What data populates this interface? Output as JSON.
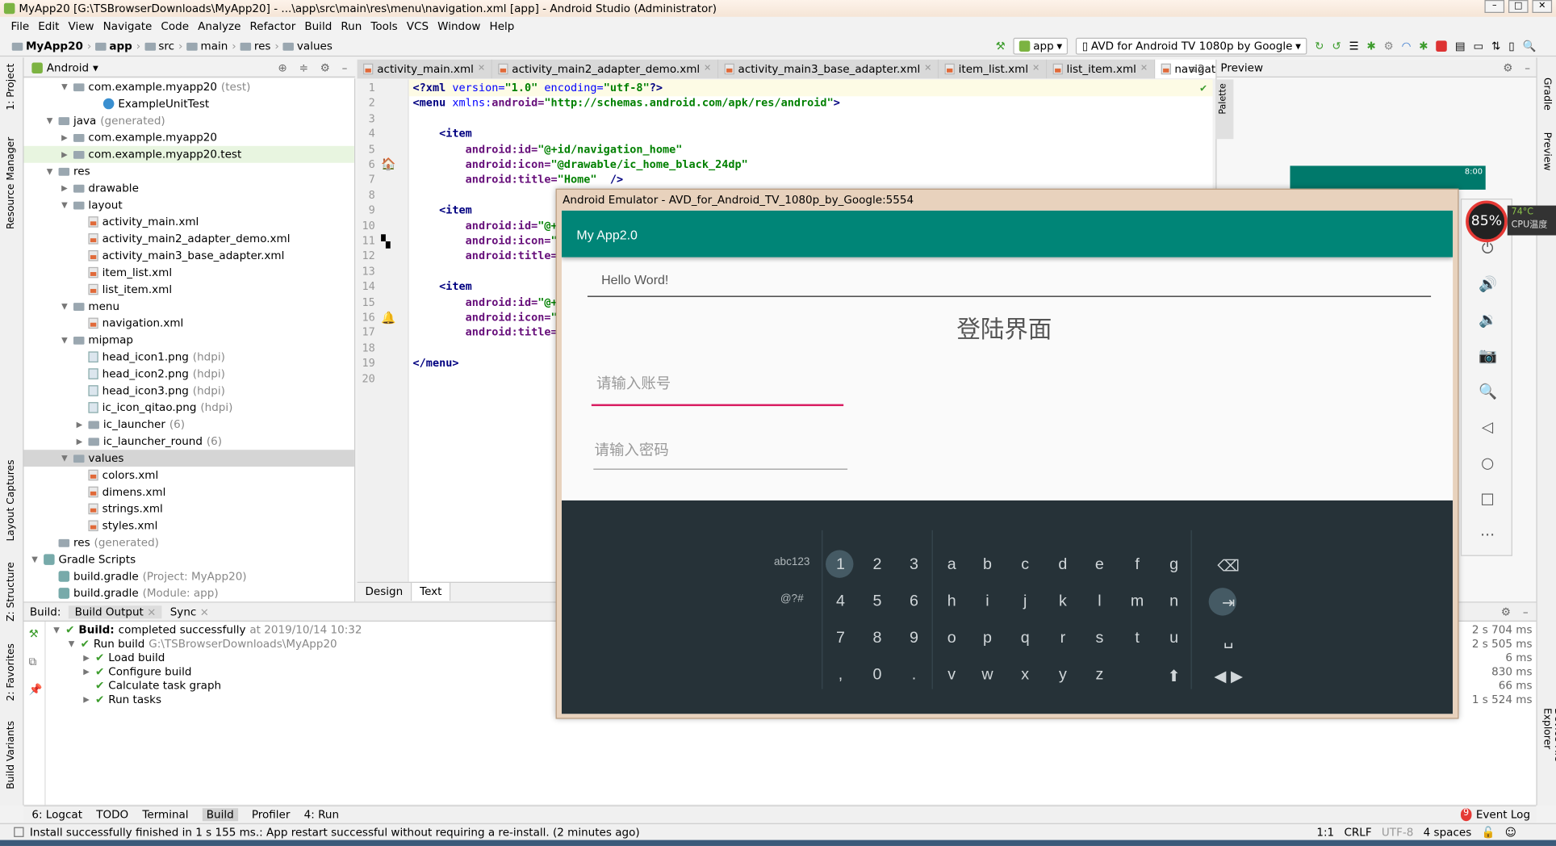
{
  "window": {
    "title": "MyApp20 [G:\\TSBrowserDownloads\\MyApp20] - ...\\app\\src\\main\\res\\menu\\navigation.xml [app] - Android Studio (Administrator)"
  },
  "menu": [
    "File",
    "Edit",
    "View",
    "Navigate",
    "Code",
    "Analyze",
    "Refactor",
    "Build",
    "Run",
    "Tools",
    "VCS",
    "Window",
    "Help"
  ],
  "breadcrumb": [
    "MyApp20",
    "app",
    "src",
    "main",
    "res",
    "values"
  ],
  "toolbar": {
    "config": "app",
    "device": "AVD for Android TV 1080p by Google"
  },
  "project": {
    "view": "Android",
    "tree": [
      {
        "label": "com.example.myapp20",
        "suffix": "(test)",
        "level": 2,
        "arrow": "▼",
        "icon": "folder"
      },
      {
        "label": "ExampleUnitTest",
        "level": 4,
        "arrow": "",
        "icon": "class"
      },
      {
        "label": "java",
        "suffix": "(generated)",
        "level": 1,
        "arrow": "▼",
        "icon": "folder"
      },
      {
        "label": "com.example.myapp20",
        "level": 2,
        "arrow": "▶",
        "icon": "folder"
      },
      {
        "label": "com.example.myapp20.test",
        "level": 2,
        "arrow": "▶",
        "icon": "folder",
        "hl": true
      },
      {
        "label": "res",
        "level": 1,
        "arrow": "▼",
        "icon": "folder"
      },
      {
        "label": "drawable",
        "level": 2,
        "arrow": "▶",
        "icon": "folder"
      },
      {
        "label": "layout",
        "level": 2,
        "arrow": "▼",
        "icon": "folder"
      },
      {
        "label": "activity_main.xml",
        "level": 3,
        "icon": "xml"
      },
      {
        "label": "activity_main2_adapter_demo.xml",
        "level": 3,
        "icon": "xml"
      },
      {
        "label": "activity_main3_base_adapter.xml",
        "level": 3,
        "icon": "xml"
      },
      {
        "label": "item_list.xml",
        "level": 3,
        "icon": "xml"
      },
      {
        "label": "list_item.xml",
        "level": 3,
        "icon": "xml"
      },
      {
        "label": "menu",
        "level": 2,
        "arrow": "▼",
        "icon": "folder"
      },
      {
        "label": "navigation.xml",
        "level": 3,
        "icon": "xml"
      },
      {
        "label": "mipmap",
        "level": 2,
        "arrow": "▼",
        "icon": "folder"
      },
      {
        "label": "head_icon1.png",
        "suffix": "(hdpi)",
        "level": 3,
        "icon": "png"
      },
      {
        "label": "head_icon2.png",
        "suffix": "(hdpi)",
        "level": 3,
        "icon": "png"
      },
      {
        "label": "head_icon3.png",
        "suffix": "(hdpi)",
        "level": 3,
        "icon": "png"
      },
      {
        "label": "ic_icon_qitao.png",
        "suffix": "(hdpi)",
        "level": 3,
        "icon": "png"
      },
      {
        "label": "ic_launcher",
        "suffix": "(6)",
        "level": 3,
        "arrow": "▶",
        "icon": "folder"
      },
      {
        "label": "ic_launcher_round",
        "suffix": "(6)",
        "level": 3,
        "arrow": "▶",
        "icon": "folder"
      },
      {
        "label": "values",
        "level": 2,
        "arrow": "▼",
        "icon": "folder",
        "sel": true
      },
      {
        "label": "colors.xml",
        "level": 3,
        "icon": "xml"
      },
      {
        "label": "dimens.xml",
        "level": 3,
        "icon": "xml"
      },
      {
        "label": "strings.xml",
        "level": 3,
        "icon": "xml"
      },
      {
        "label": "styles.xml",
        "level": 3,
        "icon": "xml"
      },
      {
        "label": "res",
        "suffix": "(generated)",
        "level": 1,
        "arrow": "",
        "icon": "folder"
      },
      {
        "label": "Gradle Scripts",
        "level": 0,
        "arrow": "▼",
        "icon": "gradle"
      },
      {
        "label": "build.gradle",
        "suffix": "(Project: MyApp20)",
        "level": 1,
        "icon": "gradle"
      },
      {
        "label": "build.gradle",
        "suffix": "(Module: app)",
        "level": 1,
        "icon": "gradle"
      }
    ]
  },
  "tabs": [
    {
      "label": "activity_main.xml"
    },
    {
      "label": "activity_main2_adapter_demo.xml"
    },
    {
      "label": "activity_main3_base_adapter.xml"
    },
    {
      "label": "item_list.xml"
    },
    {
      "label": "list_item.xml"
    },
    {
      "label": "navigation.xml",
      "active": true
    }
  ],
  "tabs_overflow": "≡2",
  "editor": {
    "lines": [
      [
        [
          "tag",
          "<?xml "
        ],
        [
          "ns",
          "version="
        ],
        [
          "val",
          "\"1.0\" "
        ],
        [
          "ns",
          "encoding="
        ],
        [
          "val",
          "\"utf-8\""
        ],
        [
          "tag",
          "?>"
        ]
      ],
      [
        [
          "tag",
          "<menu "
        ],
        [
          "ns",
          "xmlns:"
        ],
        [
          "attr",
          "android="
        ],
        [
          "val",
          "\"http://schemas.android.com/apk/res/android\""
        ],
        [
          "tag",
          ">"
        ]
      ],
      [],
      [
        [
          "tag",
          "    <item"
        ]
      ],
      [
        [
          "attr",
          "        android:id="
        ],
        [
          "val",
          "\"@+id/navigation_home\""
        ]
      ],
      [
        [
          "attr",
          "        android:icon="
        ],
        [
          "val",
          "\"@drawable/ic_home_black_24dp\""
        ]
      ],
      [
        [
          "attr",
          "        android:title="
        ],
        [
          "val",
          "\"Home\""
        ],
        [
          "tag",
          "  />"
        ]
      ],
      [],
      [
        [
          "tag",
          "    <item"
        ]
      ],
      [
        [
          "attr",
          "        android:id="
        ],
        [
          "val",
          "\"@+"
        ]
      ],
      [
        [
          "attr",
          "        android:icon="
        ],
        [
          "val",
          "\"("
        ]
      ],
      [
        [
          "attr",
          "        android:title="
        ]
      ],
      [],
      [
        [
          "tag",
          "    <item"
        ]
      ],
      [
        [
          "attr",
          "        android:id="
        ],
        [
          "val",
          "\"@+"
        ]
      ],
      [
        [
          "attr",
          "        android:icon="
        ],
        [
          "val",
          "\"("
        ]
      ],
      [
        [
          "attr",
          "        android:title="
        ]
      ],
      [],
      [
        [
          "tag",
          "</menu>"
        ]
      ],
      []
    ],
    "design_tab": "Design",
    "text_tab": "Text"
  },
  "preview": {
    "title": "Preview",
    "palette": "Palette",
    "phone_time": "8:00"
  },
  "emulator": {
    "title": "Android Emulator - AVD_for_Android_TV_1080p_by_Google:5554",
    "app_title": "My App2.0",
    "hello": "Hello Word!",
    "heading": "登陆界面",
    "account_hint": "请输入账号",
    "password_hint": "请输入密码",
    "accent": "#008577",
    "underline_focus": "#d81b60",
    "keyboard": {
      "rows": [
        [
          "abc123",
          "1",
          "2",
          "3",
          "a",
          "b",
          "c",
          "d",
          "e",
          "f",
          "g",
          "⌫"
        ],
        [
          "@?#",
          "4",
          "5",
          "6",
          "h",
          "i",
          "j",
          "k",
          "l",
          "m",
          "n",
          "⇥"
        ],
        [
          "",
          "7",
          "8",
          "9",
          "o",
          "p",
          "q",
          "r",
          "s",
          "t",
          "u",
          "␣"
        ],
        [
          "",
          ",",
          "0",
          ".",
          "v",
          "w",
          "x",
          "y",
          "z",
          "",
          "⬆",
          "◀ ▶"
        ]
      ]
    },
    "side_icons": [
      "power-icon",
      "volume-up-icon",
      "volume-down-icon",
      "camera-icon",
      "zoom-icon",
      "back-icon",
      "home-icon",
      "overview-icon",
      "more-icon"
    ]
  },
  "cpu": {
    "usage": "85%",
    "temp": "74°C",
    "label": "CPU温度"
  },
  "build": {
    "tab_label": "Build:",
    "tabs": [
      "Build Output",
      "Sync"
    ],
    "items": [
      {
        "bold": "Build:",
        "text": " completed successfully",
        "grey": " at 2019/10/14 10:32",
        "level": 0,
        "time": "2 s 704 ms"
      },
      {
        "text": "Run build",
        "grey": " G:\\TSBrowserDownloads\\MyApp20",
        "level": 1,
        "time": "2 s 505 ms"
      },
      {
        "text": "Load build",
        "level": 2,
        "time": "6 ms"
      },
      {
        "text": "Configure build",
        "level": 2,
        "time": "830 ms"
      },
      {
        "text": "Calculate task graph",
        "level": 2,
        "time": "66 ms"
      },
      {
        "text": "Run tasks",
        "level": 2,
        "time": "1 s 524 ms"
      }
    ]
  },
  "bottom_tools": [
    "6: Logcat",
    "TODO",
    "Terminal",
    "Build",
    "Profiler",
    "4: Run"
  ],
  "event_log": "Event Log",
  "event_count": "9",
  "status": {
    "message": "Install successfully finished in 1 s 155 ms.: App restart successful without requiring a re-install. (2 minutes ago)",
    "position": "1:1",
    "line_sep": "CRLF",
    "encoding": "UTF-8",
    "indent": "4 spaces"
  },
  "left_strip": [
    "1: Project",
    "Resource Manager",
    "Layout Captures",
    "Z: Structure",
    "2: Favorites",
    "Build Variants"
  ],
  "right_strip": [
    "Gradle",
    "Preview",
    "Device File Explorer"
  ]
}
